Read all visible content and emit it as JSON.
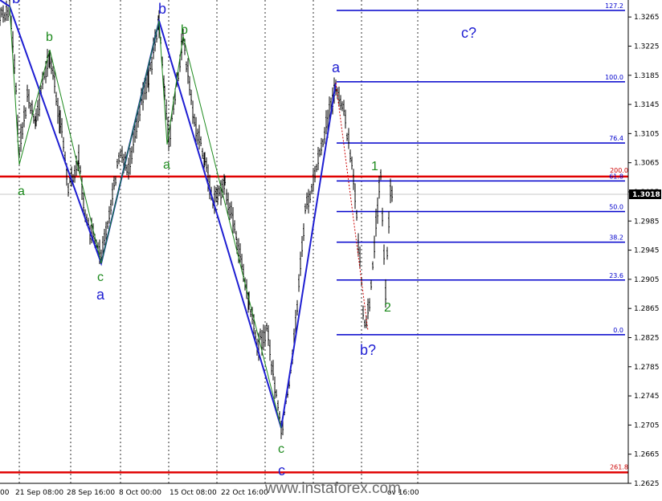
{
  "chart_data": {
    "type": "candlestick-analysis",
    "price_axis": {
      "range": [
        1.2625,
        1.3285
      ],
      "tick_labels": [
        "1.3265",
        "1.3225",
        "1.3185",
        "1.3145",
        "1.3105",
        "1.3065",
        "1.3025",
        "1.2985",
        "1.2945",
        "1.2905",
        "1.2865",
        "1.2825",
        "1.2785",
        "1.2745",
        "1.2705",
        "1.2665",
        "1.2625"
      ],
      "current_price": "1.3018"
    },
    "time_axis": {
      "tick_labels": [
        "00",
        "21 Sep 08:00",
        "28 Sep 16:00",
        "8 Oct 00:00",
        "15 Oct 08:00",
        "22 Oct 16:00",
        "",
        "ov 16:00"
      ]
    },
    "horizontal_levels": [
      {
        "label": "",
        "price": 1.3046,
        "color": "#e00000"
      },
      {
        "label": "",
        "price": 1.264,
        "color": "#e00000"
      }
    ],
    "fib_levels": [
      {
        "label": "127.2",
        "price": 1.3274
      },
      {
        "label": "100.0",
        "price": 1.3176
      },
      {
        "label": "76.4",
        "price": 1.3092
      },
      {
        "label": "61.8",
        "price": 1.304
      },
      {
        "label": "50.0",
        "price": 1.2998
      },
      {
        "label": "38.2",
        "price": 1.2956
      },
      {
        "label": "23.6",
        "price": 1.2904
      },
      {
        "label": "0.0",
        "price": 1.2829
      }
    ],
    "extra_fib_labels": [
      {
        "label": "200.0",
        "price": 1.3048
      },
      {
        "label": "261.8",
        "price": 1.2641
      }
    ],
    "wave_labels": {
      "blue": [
        "b",
        "a",
        "b",
        "a",
        "c",
        "c?",
        "b?"
      ],
      "green": [
        "a",
        "b",
        "c",
        "a",
        "b",
        "c",
        "1",
        "2"
      ]
    },
    "watermark": "www.instaforex.com"
  }
}
